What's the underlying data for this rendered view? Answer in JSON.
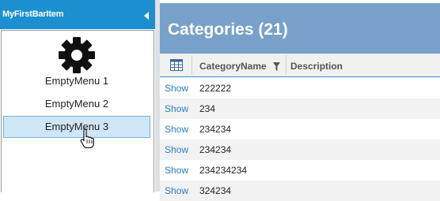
{
  "nav": {
    "title": "MyFirstBarItem",
    "menu_items": [
      {
        "label": "EmptyMenu 1"
      },
      {
        "label": "EmptyMenu 2"
      },
      {
        "label": "EmptyMenu 3"
      }
    ]
  },
  "page": {
    "title": "Categories (21)"
  },
  "grid": {
    "columns": [
      "CategoryName",
      "Description"
    ],
    "row_link": "Show",
    "rows": [
      {
        "name": "222222"
      },
      {
        "name": "234"
      },
      {
        "name": "234234"
      },
      {
        "name": "234234"
      },
      {
        "name": "234234234"
      },
      {
        "name": "324234"
      }
    ]
  },
  "colors": {
    "nav_header": "#1c8fd1",
    "page_header": "#77a1c8",
    "link": "#2b7fc4",
    "selected_item": "#cfe6f6"
  }
}
